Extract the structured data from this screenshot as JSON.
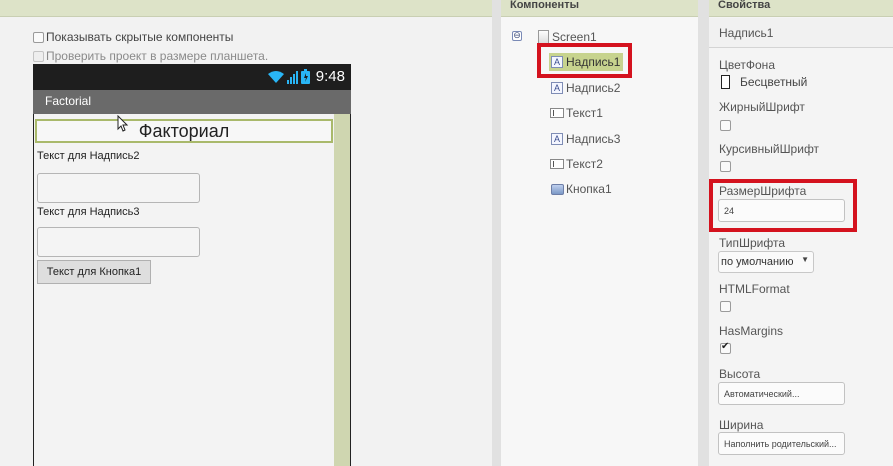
{
  "viewer": {
    "show_hidden_label": "Показывать скрытые компоненты",
    "tablet_preview_label": "Проверить проект в размере планшета.",
    "phone": {
      "time": "9:48",
      "app_title": "Factorial",
      "label1_text": "Факториал",
      "label2_text": "Текст для Надпись2",
      "label3_text": "Текст для Надпись3",
      "button1_text": "Текст для Кнопка1"
    }
  },
  "components": {
    "header": "Компоненты",
    "collapse_symbol": "⊖",
    "items": [
      {
        "name": "Screen1",
        "icon": "screen-icon"
      },
      {
        "name": "Надпись1",
        "icon": "label-icon",
        "selected": true
      },
      {
        "name": "Надпись2",
        "icon": "label-icon"
      },
      {
        "name": "Текст1",
        "icon": "textbox-icon"
      },
      {
        "name": "Надпись3",
        "icon": "label-icon"
      },
      {
        "name": "Текст2",
        "icon": "textbox-icon"
      },
      {
        "name": "Кнопка1",
        "icon": "button-icon"
      }
    ],
    "label_icon_glyph": "A"
  },
  "properties": {
    "header": "Свойства",
    "component_name": "Надпись1",
    "bg_color_label": "ЦветФона",
    "bg_color_value": "Бесцветный",
    "bold_label": "ЖирныйШрифт",
    "bold_checked": false,
    "italic_label": "КурсивныйШрифт",
    "italic_checked": false,
    "font_size_label": "РазмерШрифта",
    "font_size_value": "24",
    "font_type_label": "ТипШрифта",
    "font_type_value": "по умолчанию",
    "html_format_label": "HTMLFormat",
    "html_format_checked": false,
    "has_margins_label": "HasMargins",
    "has_margins_checked": true,
    "height_label": "Высота",
    "height_value": "Автоматический...",
    "width_label": "Ширина",
    "width_value": "Наполнить родительский..."
  },
  "colors": {
    "header_bg": "#dde3c8",
    "selection": "#c7d38e",
    "highlight_box": "#d4121e",
    "label_border": "#a9b96b"
  }
}
